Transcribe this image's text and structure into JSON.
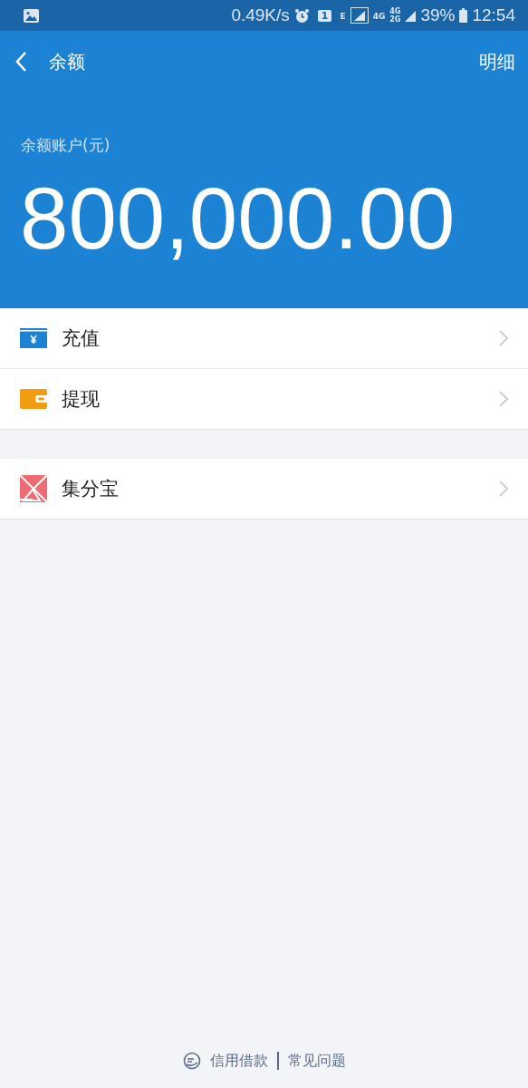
{
  "status_bar": {
    "speed": "0.49K/s",
    "sim": "1",
    "net_type": "E",
    "net_a": "4G",
    "net_b_top": "4G",
    "net_b_bottom": "2G",
    "battery": "39%",
    "time": "12:54"
  },
  "header": {
    "title": "余额",
    "action": "明细"
  },
  "balance": {
    "label": "余额账户(元)",
    "amount": "800,000.00"
  },
  "groups": [
    {
      "items": [
        {
          "kind": "recharge",
          "label": "充值"
        },
        {
          "kind": "withdraw",
          "label": "提现"
        }
      ]
    },
    {
      "items": [
        {
          "kind": "points",
          "label": "集分宝"
        }
      ]
    }
  ],
  "footer": {
    "links": [
      "信用借款",
      "常见问题"
    ]
  }
}
